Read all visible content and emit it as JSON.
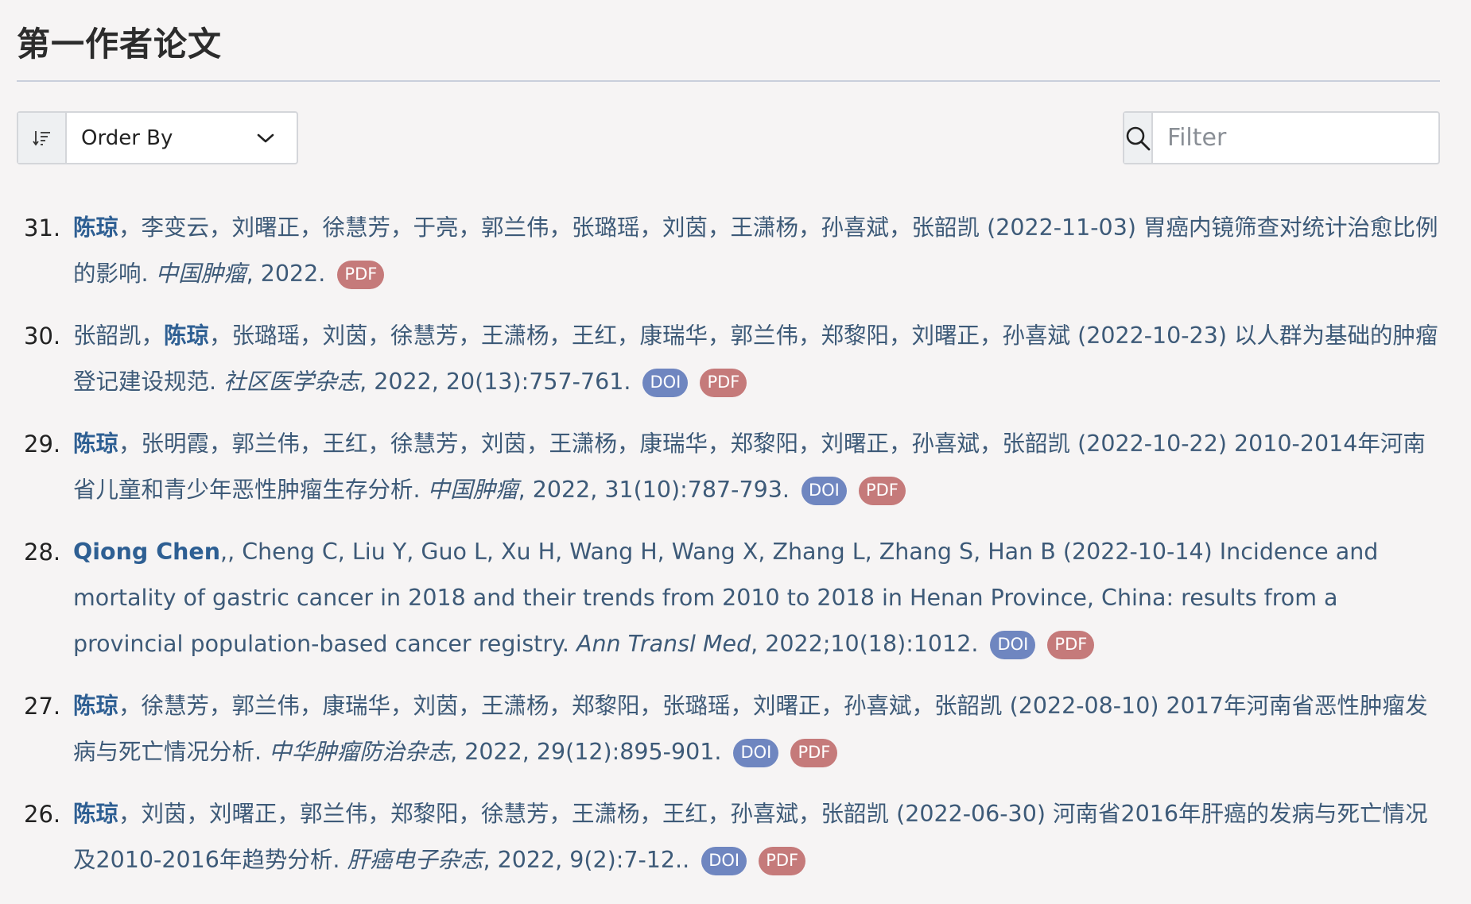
{
  "page": {
    "heading": "第一作者论文"
  },
  "toolbar": {
    "order_by_label": "Order By",
    "filter_placeholder": "Filter"
  },
  "colors": {
    "lead_author": "#2e5f93",
    "text": "#3d5a78",
    "doi_badge": "#6f86c0",
    "pdf_badge": "#c57a7a"
  },
  "publications": [
    {
      "number": "31.",
      "lead": "陈琼",
      "rest": "，李变云，刘曙正，徐慧芳，于亮，郭兰伟，张璐瑶，刘茵，王潇杨，孙喜斌，张韶凯 (2022-11-03) 胃癌内镜筛查对统计治愈比例的影响. ",
      "journal": "中国肿瘤",
      "citation": ", 2022.",
      "doi": "",
      "pdf": "PDF"
    },
    {
      "number": "30.",
      "before": "张韶凯，",
      "lead": "陈琼",
      "rest": "，张璐瑶，刘茵，徐慧芳，王潇杨，王红，康瑞华，郭兰伟，郑黎阳，刘曙正，孙喜斌 (2022-10-23) 以人群为基础的肿瘤登记建设规范. ",
      "journal": "社区医学杂志",
      "citation": ", 2022, 20(13):757-761.",
      "doi": "DOI",
      "pdf": "PDF"
    },
    {
      "number": "29.",
      "lead": "陈琼",
      "rest": "，张明霞，郭兰伟，王红，徐慧芳，刘茵，王潇杨，康瑞华，郑黎阳，刘曙正，孙喜斌，张韶凯 (2022-10-22) 2010-2014年河南省儿童和青少年恶性肿瘤生存分析. ",
      "journal": "中国肿瘤",
      "citation": ", 2022, 31(10):787-793.",
      "doi": "DOI",
      "pdf": "PDF"
    },
    {
      "number": "28.",
      "lead": "Qiong Chen",
      "rest": ",, Cheng C, Liu Y, Guo L, Xu H, Wang H, Wang X, Zhang L, Zhang S, Han B (2022-10-14) Incidence and mortality of gastric cancer in 2018 and their trends from 2010 to 2018 in Henan Province, China: results from a provincial population-based cancer registry. ",
      "journal": "Ann Transl Med",
      "citation": ", 2022;10(18):1012.",
      "doi": "DOI",
      "pdf": "PDF"
    },
    {
      "number": "27.",
      "lead": "陈琼",
      "rest": "，徐慧芳，郭兰伟，康瑞华，刘茵，王潇杨，郑黎阳，张璐瑶，刘曙正，孙喜斌，张韶凯 (2022-08-10) 2017年河南省恶性肿瘤发病与死亡情况分析. ",
      "journal": "中华肿瘤防治杂志",
      "citation": ", 2022, 29(12):895-901.",
      "doi": "DOI",
      "pdf": "PDF"
    },
    {
      "number": "26.",
      "lead": "陈琼",
      "rest": "，刘茵，刘曙正，郭兰伟，郑黎阳，徐慧芳，王潇杨，王红，孙喜斌，张韶凯 (2022-06-30) 河南省2016年肝癌的发病与死亡情况及2010-2016年趋势分析. ",
      "journal": "肝癌电子杂志",
      "citation": ", 2022, 9(2):7-12..",
      "doi": "DOI",
      "pdf": "PDF"
    }
  ]
}
